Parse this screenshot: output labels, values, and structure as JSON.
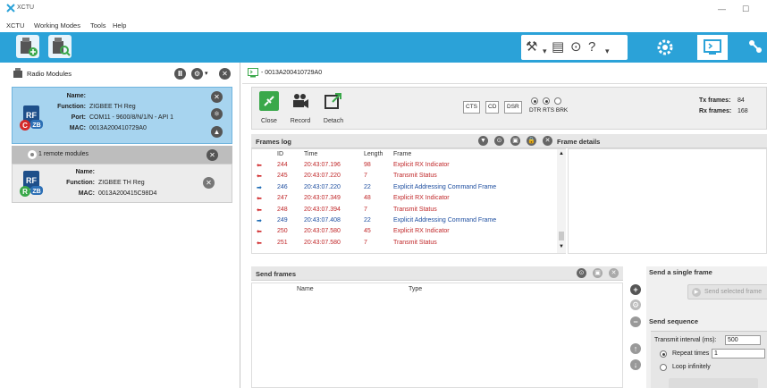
{
  "window": {
    "title": "XCTU",
    "minimize": "—",
    "maximize": "☐"
  },
  "menu": [
    "XCTU",
    "Working Modes",
    "Tools",
    "Help"
  ],
  "colors": {
    "toolbar": "#2ba2d8",
    "module_selected": "#a7d4ef",
    "rx_arrow": "#d0282a",
    "tx_arrow": "#1f6db5",
    "rx_text": "#c0282a",
    "tx_text": "#1f4fa0"
  },
  "radio_modules": {
    "title": "Radio Modules",
    "local": {
      "name_label": "Name:",
      "name_value": "",
      "function_label": "Function:",
      "function_value": "ZIGBEE TH Reg",
      "port_label": "Port:",
      "port_value": "COM11 - 9600/8/N/1/N - API 1",
      "mac_label": "MAC:",
      "mac_value": "0013A200410729A0"
    },
    "remote_header": "1 remote modules",
    "remote": {
      "name_label": "Name:",
      "name_value": "",
      "function_label": "Function:",
      "function_value": "ZIGBEE TH Reg",
      "mac_label": "MAC:",
      "mac_value": "0013A200415C98D4"
    }
  },
  "console": {
    "tab_title": "- 0013A200410729A0",
    "actions": {
      "close": "Close",
      "record": "Record",
      "detach": "Detach"
    },
    "signals": {
      "cts": "CTS",
      "cd": "CD",
      "dsr": "DSR",
      "dtr_rts_brk": "DTR RTS BRK"
    },
    "tx_frames_label": "Tx frames:",
    "tx_frames_value": "84",
    "rx_frames_label": "Rx frames:",
    "rx_frames_value": "168"
  },
  "frames_log": {
    "title": "Frames log",
    "details_title": "Frame details",
    "columns": [
      "ID",
      "Time",
      "Length",
      "Frame"
    ],
    "rows": [
      {
        "dir": "rx",
        "id": "244",
        "time": "20:43:07.196",
        "length": "98",
        "frame": "Explicit RX Indicator"
      },
      {
        "dir": "rx",
        "id": "245",
        "time": "20:43:07.220",
        "length": "7",
        "frame": "Transmit Status"
      },
      {
        "dir": "tx",
        "id": "246",
        "time": "20:43:07.220",
        "length": "22",
        "frame": "Explicit Addressing Command Frame"
      },
      {
        "dir": "rx",
        "id": "247",
        "time": "20:43:07.349",
        "length": "48",
        "frame": "Explicit RX Indicator"
      },
      {
        "dir": "rx",
        "id": "248",
        "time": "20:43:07.394",
        "length": "7",
        "frame": "Transmit Status"
      },
      {
        "dir": "tx",
        "id": "249",
        "time": "20:43:07.408",
        "length": "22",
        "frame": "Explicit Addressing Command Frame"
      },
      {
        "dir": "rx",
        "id": "250",
        "time": "20:43:07.580",
        "length": "45",
        "frame": "Explicit RX Indicator"
      },
      {
        "dir": "rx",
        "id": "251",
        "time": "20:43:07.580",
        "length": "7",
        "frame": "Transmit Status"
      }
    ]
  },
  "send_frames": {
    "title": "Send frames",
    "columns": [
      "Name",
      "Type"
    ]
  },
  "send_single": {
    "title": "Send a single frame",
    "button": "Send selected frame",
    "sequence_title": "Send sequence",
    "interval_label": "Transmit interval (ms):",
    "interval_value": "500",
    "repeat_label": "Repeat times",
    "repeat_value": "1",
    "loop_label": "Loop infinitely"
  }
}
